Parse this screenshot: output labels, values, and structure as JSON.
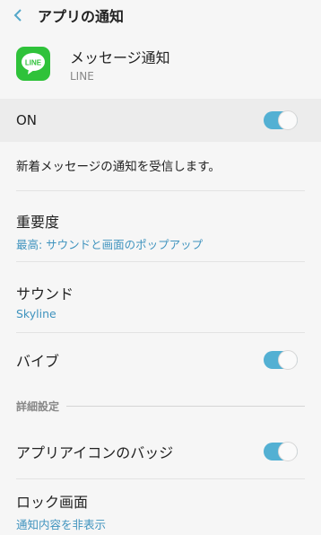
{
  "header": {
    "title": "アプリの通知",
    "back_icon": "chevron-left-icon"
  },
  "app": {
    "name": "メッセージ通知",
    "subtitle": "LINE",
    "icon_text": "LINE",
    "icon_color": "#2fc23a"
  },
  "master_toggle": {
    "label": "ON",
    "state": true
  },
  "description": "新着メッセージの通知を受信します。",
  "settings": {
    "importance": {
      "title": "重要度",
      "value": "最高: サウンドと画面のポップアップ"
    },
    "sound": {
      "title": "サウンド",
      "value": "Skyline"
    },
    "vibrate": {
      "title": "バイブ",
      "state": true
    }
  },
  "advanced": {
    "section_label": "詳細設定",
    "app_badge": {
      "title": "アプリアイコンのバッジ",
      "state": true
    },
    "lock_screen": {
      "title": "ロック画面",
      "value": "通知内容を非表示"
    }
  },
  "colors": {
    "accent": "#53b0d3",
    "link": "#3f93be",
    "background": "#f6f6f6"
  }
}
